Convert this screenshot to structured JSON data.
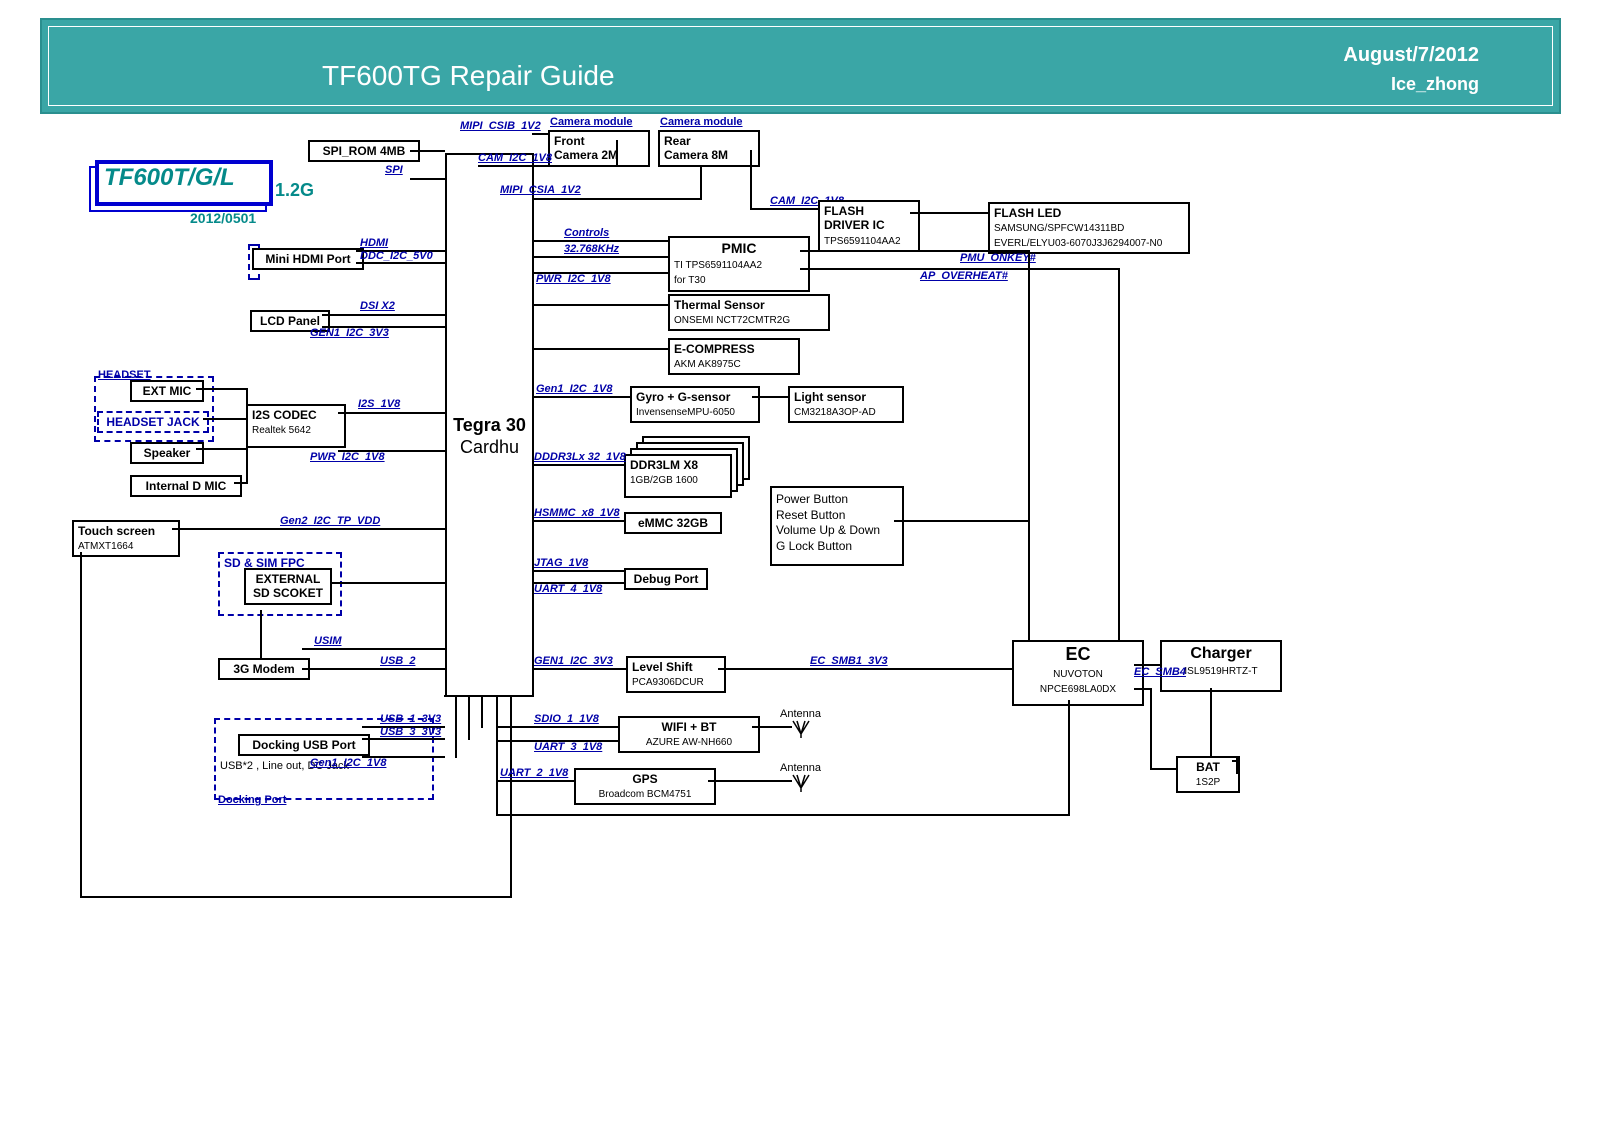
{
  "header": {
    "title": "TF600TG Repair Guide",
    "date": "August/7/2012",
    "author": "Ice_zhong"
  },
  "model": {
    "name": "TF600T/G/L",
    "freq": "1.2G",
    "date": "2012/0501"
  },
  "soc": {
    "name": "Tegra 30",
    "sub": "Cardhu"
  },
  "blocks": {
    "spi_rom": "SPI_ROM 4MB",
    "cam_front_link": "Camera module",
    "cam_front": "Front\nCamera 2M",
    "cam_rear_link": "Camera module",
    "cam_rear": "Rear\nCamera 8M",
    "flash_drv": "FLASH\nDRIVER IC",
    "flash_drv_sub": "TPS6591104AA2",
    "flash_led": "FLASH LED",
    "flash_led_sub1": "SAMSUNG/SPFCW14311BD",
    "flash_led_sub2": "EVERL/ELYU03-6070J3J6294007-N0",
    "mini_hdmi": "Mini HDMI Port",
    "lcd": "LCD Panel",
    "ext_mic": "EXT MIC",
    "headset": "HEADSET",
    "hsjack": "HEADSET JACK",
    "speaker": "Speaker",
    "int_dmic": "Internal D MIC",
    "codec": "I2S CODEC",
    "codec_sub": "Realtek 5642",
    "touch": "Touch screen",
    "touch_sub": "ATMXT1664",
    "sdsim": "SD & SIM FPC",
    "ext_sd": "EXTERNAL\nSD SCOKET",
    "modem": "3G Modem",
    "dockusb": "Docking USB Port",
    "dockdesc": "USB*2 , Line out, DC Jack",
    "dockport": "Docking Port",
    "pmic": "PMIC",
    "pmic_sub": "TI TPS6591104AA2\nfor T30",
    "thermal": "Thermal Sensor",
    "thermal_sub": "ONSEMI NCT72CMTR2G",
    "ecomp": "E-COMPRESS",
    "ecomp_sub": "AKM AK8975C",
    "gyro": "Gyro + G-sensor",
    "gyro_sub": "InvensenseMPU-6050",
    "light": "Light sensor",
    "light_sub": "CM3218A3OP-AD",
    "ddr": "DDR3LM X8",
    "ddr_sub": "1GB/2GB 1600",
    "emmc": "eMMC 32GB",
    "buttons": "Power Button\nReset Button\nVolume Up & Down\nG Lock Button",
    "debug": "Debug Port",
    "lvlshift": "Level Shift",
    "lvlshift_sub": "PCA9306DCUR",
    "wifibt": "WIFI + BT",
    "wifibt_sub": "AZURE  AW-NH660",
    "gps": "GPS",
    "gps_sub": "Broadcom BCM4751",
    "ec": "EC",
    "ec_sub1": "NUVOTON",
    "ec_sub2": "NPCE698LA0DX",
    "charger": "Charger",
    "charger_sub": "ISL9519HRTZ-T",
    "bat": "BAT",
    "bat_sub": "1S2P",
    "antenna": "Antenna"
  },
  "signals": {
    "mipi_csib": "MIPI_CSIB_1V2",
    "cam_i2c": "CAM_I2C_1V8",
    "spi": "SPI",
    "mipi_csia": "MIPI_CSIA_1V2",
    "cam_i2c2": "CAM_I2C_1V8",
    "hdmi": "HDMI",
    "ddc": "DDC_I2C_5V0",
    "dsi": "DSI  X2",
    "gen1_i2c_3v3": "GEN1_I2C_3V3",
    "i2s": "I2S_1V8",
    "pwr_i2c": "PWR_I2C_1V8",
    "gen2_tp": "Gen2_I2C_TP_VDD",
    "usim": "USIM",
    "usb2": "USB_2",
    "usb1": "USB_1_3V3",
    "usb3": "USB_3_3V3",
    "gen1_i2c_1v8": "Gen1_I2C_1V8",
    "controls": "Controls",
    "khz": "32.768KHz",
    "pwr_i2c2": "PWR_I2C_1V8",
    "pmu_onkey": "PMU_ONKEY#",
    "ap_over": "AP_OVERHEAT#",
    "gen1_i2c_g": "Gen1_I2C_1V8",
    "ddr3lx": "DDDR3Lx 32_1V8",
    "hsmmc": "HSMMC_x8_1V8",
    "jtag": "JTAG_1V8",
    "uart4": "UART_4_1V8",
    "gen1_3v3b": "GEN1_I2C_3V3",
    "ec_smb1": "EC_SMB1_3V3",
    "sdio1": "SDIO_1_1V8",
    "uart3": "UART_3_1V8",
    "uart2": "UART_2_1V8",
    "ec_smb4": "EC_SMB4"
  }
}
